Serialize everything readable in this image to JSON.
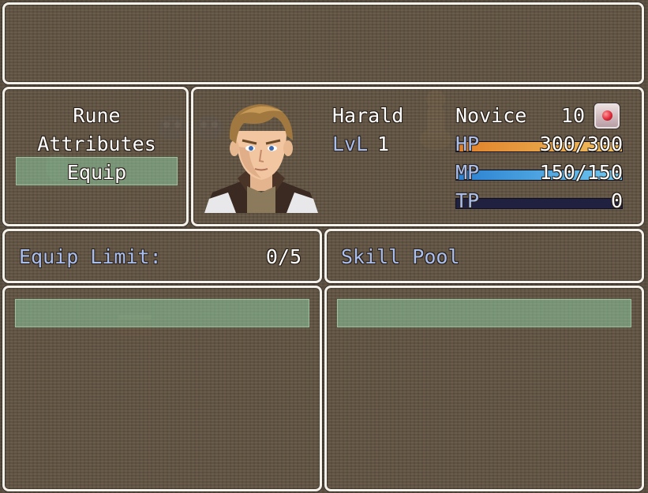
{
  "help_window": {
    "text": ""
  },
  "command_menu": {
    "items": [
      "Rune",
      "Attributes",
      "Equip"
    ],
    "selected_index": 2
  },
  "actor": {
    "name": "Harald",
    "level_label": "LvL",
    "level": "1",
    "class": "Novice",
    "rank": "10",
    "hp_label": "HP",
    "hp_value": "300/300",
    "hp_fraction": 1.0,
    "mp_label": "MP",
    "mp_value": "150/150",
    "mp_fraction": 1.0,
    "tp_label": "TP",
    "tp_value": "0",
    "tp_fraction": 0.0,
    "state_icon": "red-orb-icon"
  },
  "equip_limit": {
    "label": "Equip Limit:",
    "value": "0/5"
  },
  "skill_pool": {
    "label": "Skill Pool"
  },
  "colors": {
    "hp_start": "#e0802a",
    "hp_end": "#f0c060",
    "mp_start": "#2a80d0",
    "mp_end": "#70c8f0",
    "system": "#a9bff0",
    "window_border": "#f4f1ea"
  }
}
